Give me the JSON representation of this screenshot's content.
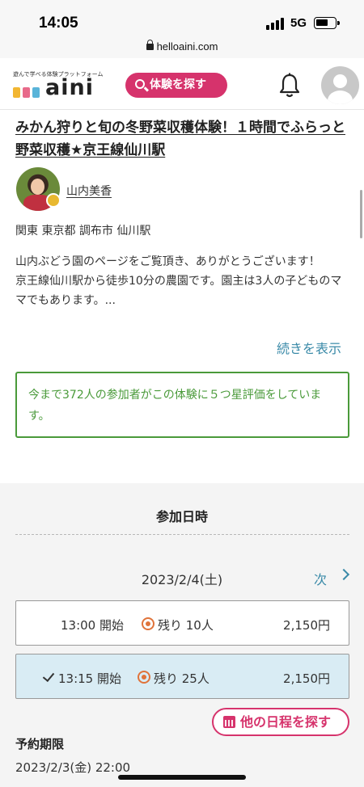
{
  "status_bar": {
    "time": "14:05",
    "network": "5G"
  },
  "browser": {
    "url": "helloaini.com"
  },
  "header": {
    "logo_tagline": "遊んで学べる体験プラットフォーム",
    "logo_word": "aini",
    "search_button": "体験を探す",
    "logo_colors": [
      "#f2b632",
      "#e86a8a",
      "#59b4d9"
    ]
  },
  "experience": {
    "title": "みかん狩りと旬の冬野菜収穫体験！１時間でふらっと野菜収穫★京王線仙川駅",
    "host_name": "山内美香",
    "location": "関東 東京都 調布市 仙川駅",
    "description": "山内ぶどう園のページをご覧頂き、ありがとうございます！\n京王線仙川駅から徒歩10分の農園です。園主は3人の子どものママでもあります。...",
    "show_more": "続きを表示",
    "rating_text": "今まで372人の参加者がこの体験に５つ星評価をしています。"
  },
  "schedule": {
    "section_title": "参加日時",
    "date": "2023/2/4(土)",
    "next_label": "次",
    "slots": [
      {
        "time": "13:00 開始",
        "remaining": "残り 10人",
        "price": "2,150円",
        "selected": false
      },
      {
        "time": "13:15 開始",
        "remaining": "残り 25人",
        "price": "2,150円",
        "selected": true
      }
    ],
    "other_dates_button": "他の日程を探す",
    "deadline_label": "予約期限",
    "deadline_value": "2023/2/3(金) 22:00"
  },
  "colors": {
    "brand_pink": "#d6336c",
    "link_blue": "#3a8aa8",
    "rating_green": "#4a9a3a",
    "selected_slot_bg": "#d9ecf4"
  }
}
